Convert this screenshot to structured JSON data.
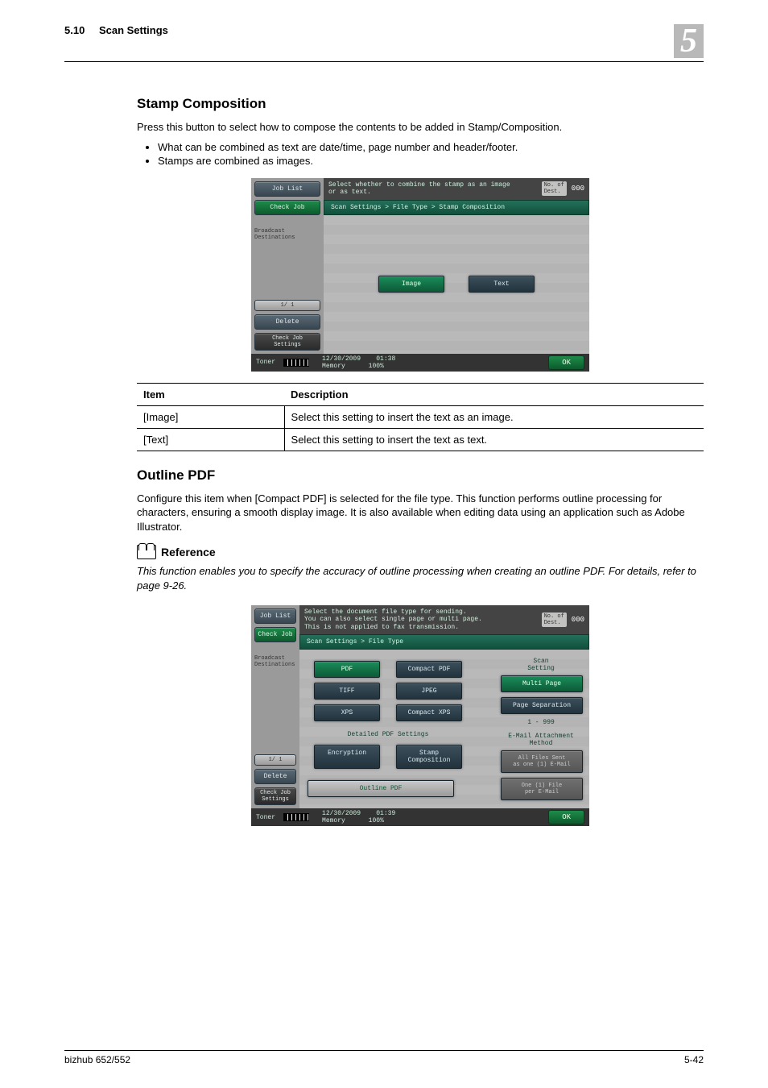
{
  "header": {
    "section_no": "5.10",
    "section_title": "Scan Settings",
    "chapter_no": "5"
  },
  "h_stamp": "Stamp Composition",
  "p_stamp_intro": "Press this button to select how to compose the contents to be added in Stamp/Composition.",
  "bullets": [
    "What can be combined as text are date/time, page number and header/footer.",
    "Stamps are combined as images."
  ],
  "mfp1": {
    "job_list": "Job List",
    "check_job": "Check Job",
    "broadcast": "Broadcast\nDestinations",
    "paging": "1/  1",
    "delete": "Delete",
    "check_job_settings": "Check Job\nSettings",
    "toner": "Toner",
    "hint": "Select whether to combine the stamp as an image or as text.",
    "dest_label": "No. of\nDest.",
    "dest_count": "000",
    "crumb": "Scan Settings > File Type > Stamp Composition",
    "opt_image": "Image",
    "opt_text": "Text",
    "date": "12/30/2009",
    "time": "01:38",
    "mem_label": "Memory",
    "mem_val": "100%",
    "ok": "OK"
  },
  "table": {
    "h_item": "Item",
    "h_desc": "Description",
    "rows": [
      {
        "item": "[Image]",
        "desc": "Select this setting to insert the text as an image."
      },
      {
        "item": "[Text]",
        "desc": "Select this setting to insert the text as text."
      }
    ]
  },
  "h_outline": "Outline PDF",
  "p_outline": "Configure this item when [Compact PDF] is selected for the file type. This function performs outline processing for characters, ensuring a smooth display image. It is also available when editing data using an application such as Adobe Illustrator.",
  "ref_label": "Reference",
  "ref_body": "This function enables you to specify the accuracy of outline processing when creating an outline PDF. For details, refer to page 9-26.",
  "mfp2": {
    "job_list": "Job List",
    "check_job": "Check Job",
    "broadcast": "Broadcast\nDestinations",
    "paging": "1/  1",
    "delete": "Delete",
    "check_job_settings": "Check Job\nSettings",
    "toner": "Toner",
    "hint": "Select the document file type for sending.\nYou can also select single page or multi page.\nThis is not applied to fax transmission.",
    "dest_label": "No. of\nDest.",
    "dest_count": "000",
    "crumb": "Scan Settings > File Type",
    "pdf": "PDF",
    "cpdf": "Compact PDF",
    "tiff": "TIFF",
    "jpeg": "JPEG",
    "xps": "XPS",
    "cxps": "Compact XPS",
    "detailed": "Detailed PDF Settings",
    "encryption": "Encryption",
    "stampcomp": "Stamp Composition",
    "outline_pdf": "Outline PDF",
    "scan_setting": "Scan\nSetting",
    "multi_page": "Multi Page",
    "page_sep": "Page Separation",
    "range": "1    -   999",
    "email_method": "E-Mail Attachment\nMethod",
    "all_files": "All Files Sent\nas one (1) E-Mail",
    "one_file": "One (1) File\nper E-Mail",
    "date": "12/30/2009",
    "time": "01:39",
    "mem_label": "Memory",
    "mem_val": "100%",
    "ok": "OK"
  },
  "footer": {
    "model": "bizhub 652/552",
    "page": "5-42"
  }
}
